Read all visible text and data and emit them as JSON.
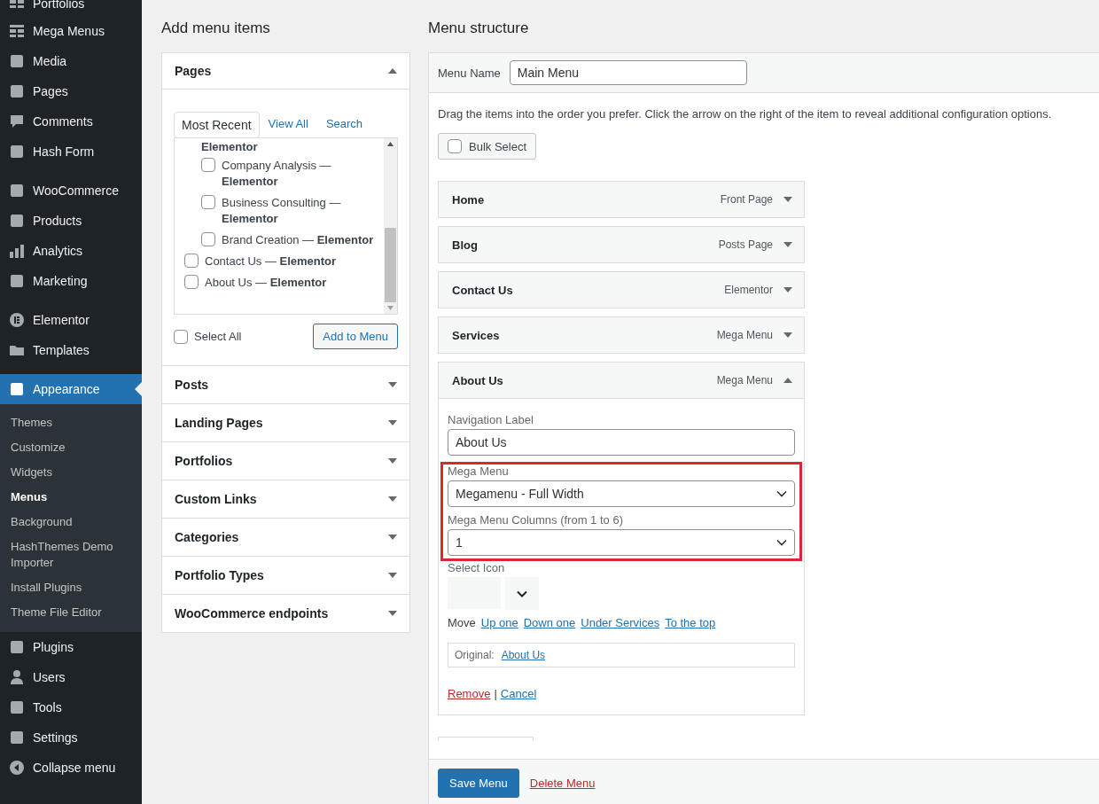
{
  "sidebar": {
    "groups": [
      {
        "items": [
          {
            "label": "Portfolios",
            "selected": false
          },
          {
            "label": "Mega Menus",
            "selected": false
          },
          {
            "label": "Media",
            "selected": false
          },
          {
            "label": "Pages",
            "selected": false
          },
          {
            "label": "Comments",
            "selected": false
          },
          {
            "label": "Hash Form",
            "selected": false
          }
        ]
      },
      {
        "items": [
          {
            "label": "WooCommerce",
            "selected": false
          },
          {
            "label": "Products",
            "selected": false
          },
          {
            "label": "Analytics",
            "selected": false
          },
          {
            "label": "Marketing",
            "selected": false
          }
        ]
      },
      {
        "items": [
          {
            "label": "Elementor",
            "selected": false
          },
          {
            "label": "Templates",
            "selected": false
          }
        ]
      },
      {
        "items": [
          {
            "label": "Appearance",
            "selected": true,
            "submenu": [
              {
                "label": "Themes",
                "selected": false
              },
              {
                "label": "Customize",
                "selected": false
              },
              {
                "label": "Widgets",
                "selected": false
              },
              {
                "label": "Menus",
                "selected": true
              },
              {
                "label": "Background",
                "selected": false
              },
              {
                "label": "HashThemes Demo Importer",
                "selected": false
              },
              {
                "label": "Install Plugins",
                "selected": false
              },
              {
                "label": "Theme File Editor",
                "selected": false
              }
            ]
          },
          {
            "label": "Plugins",
            "selected": false
          },
          {
            "label": "Users",
            "selected": false
          },
          {
            "label": "Tools",
            "selected": false
          },
          {
            "label": "Settings",
            "selected": false
          },
          {
            "label": "Collapse menu",
            "selected": false
          }
        ]
      }
    ]
  },
  "add_menu_items": {
    "title": "Add menu items",
    "sections": [
      {
        "title": "Pages",
        "expanded": true,
        "tabs": [
          {
            "label": "Most Recent",
            "selected": true
          },
          {
            "label": "View All",
            "selected": false
          },
          {
            "label": "Search",
            "selected": false
          }
        ],
        "items": [
          {
            "kind": "fragment",
            "label": "**Elementor**",
            "children": [
              {
                "label": "Company Analysis — **Elementor**",
                "checked": false
              },
              {
                "label": "Business Consulting — **Elementor**",
                "checked": false
              },
              {
                "label": "Brand Creation — **Elementor**",
                "checked": false
              }
            ]
          },
          {
            "kind": "page",
            "label": "Contact Us — **Elementor**",
            "checked": false
          },
          {
            "kind": "page",
            "label": "About Us — **Elementor**",
            "checked": false
          }
        ],
        "select_all": {
          "label": "Select All",
          "checked": false
        },
        "button": "Add to Menu"
      },
      {
        "title": "Posts",
        "expanded": false
      },
      {
        "title": "Landing Pages",
        "expanded": false
      },
      {
        "title": "Portfolios",
        "expanded": false
      },
      {
        "title": "Custom Links",
        "expanded": false
      },
      {
        "title": "Categories",
        "expanded": false
      },
      {
        "title": "Portfolio Types",
        "expanded": false
      },
      {
        "title": "WooCommerce endpoints",
        "expanded": false
      }
    ]
  },
  "menu_structure": {
    "title": "Menu structure",
    "menu_name": {
      "label": "Menu Name",
      "value": "Main Menu"
    },
    "instructions": "Drag the items into the order you prefer. Click the arrow on the right of the item to reveal additional configuration options.",
    "bulk_select": {
      "label": "Bulk Select",
      "checked": false
    },
    "items": [
      {
        "title": "Home",
        "type": "Front Page",
        "expanded": false
      },
      {
        "title": "Blog",
        "type": "Posts Page",
        "expanded": false
      },
      {
        "title": "Contact Us",
        "type": "Elementor",
        "expanded": false
      },
      {
        "title": "Services",
        "type": "Mega Menu",
        "expanded": false
      },
      {
        "title": "About Us",
        "type": "Mega Menu",
        "expanded": true,
        "settings": {
          "navigation_label": {
            "label": "Navigation Label",
            "value": "About Us"
          },
          "mega_menu": {
            "highlighted": true,
            "fields": [
              {
                "label": "Mega Menu",
                "value": "Megamenu - Full Width"
              },
              {
                "label": "Mega Menu Columns (from 1 to 6)",
                "value": "1"
              }
            ]
          },
          "select_icon": {
            "label": "Select Icon"
          },
          "move": {
            "label": "Move",
            "links": [
              "Up one",
              "Down one",
              "Under Services",
              "To the top"
            ]
          },
          "original": {
            "label": "Original:",
            "link": "About Us"
          },
          "remove": "Remove",
          "separator": "|",
          "cancel": "Cancel"
        }
      }
    ],
    "save_button": "Save Menu",
    "delete_link": "Delete Menu"
  }
}
